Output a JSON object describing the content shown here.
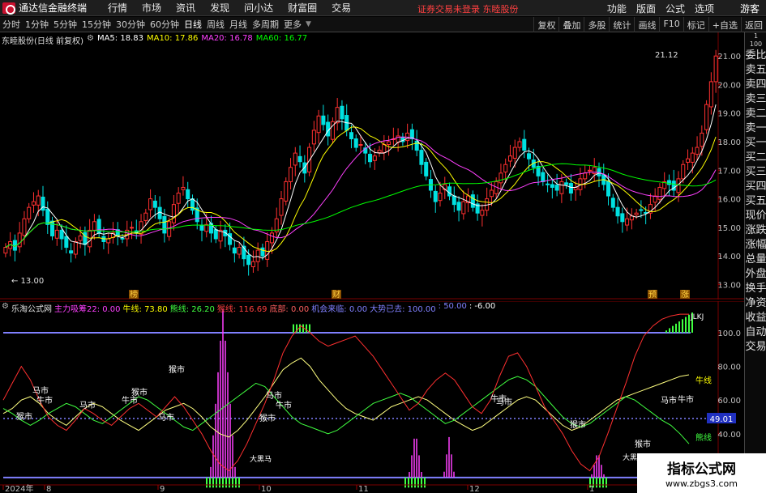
{
  "titlebar": {
    "app_title": "通达信金融终端",
    "menu": [
      "行情",
      "市场",
      "资讯",
      "发现",
      "问小达",
      "财富圈",
      "交易"
    ],
    "notice": "证券交易未登录  东睦股份",
    "right_menu": [
      "功能",
      "版面",
      "公式",
      "选项"
    ],
    "guest": "游客"
  },
  "toolbar": {
    "periods": [
      "分时",
      "1分钟",
      "5分钟",
      "15分钟",
      "30分钟",
      "60分钟",
      "日线",
      "周线",
      "月线",
      "多周期",
      "更多"
    ],
    "active_period": "日线",
    "tools": [
      "复权",
      "叠加",
      "多股",
      "统计",
      "画线",
      "F10",
      "标记",
      "+自选",
      "返回"
    ]
  },
  "main_chart": {
    "stock_label": "东睦股份(日线 前复权)",
    "ma": [
      {
        "label": "MA5: 18.83",
        "color": "#ffffff"
      },
      {
        "label": "MA10: 17.86",
        "color": "#ffff00"
      },
      {
        "label": "MA20: 16.78",
        "color": "#ff40ff"
      },
      {
        "label": "MA60: 16.77",
        "color": "#00ff00"
      }
    ],
    "high_label": "21.12",
    "low_label": "13.00",
    "event_markers": [
      {
        "text": "榜",
        "x": 165
      },
      {
        "text": "财",
        "x": 415
      },
      {
        "text": "预",
        "x": 805
      },
      {
        "text": "涨",
        "x": 845
      }
    ]
  },
  "chart_data": [
    {
      "type": "candlestick",
      "ylim": [
        12.7,
        21.6
      ],
      "yticks": [
        "21.00",
        "20.00",
        "19.00",
        "18.00",
        "17.00",
        "16.00",
        "15.00",
        "14.00",
        "13.00"
      ],
      "ytick_values": [
        21,
        20,
        19,
        18,
        17,
        16,
        15,
        14,
        13
      ],
      "close": [
        14.3,
        14.5,
        14.2,
        14.8,
        15.3,
        15.7,
        15.9,
        16.1,
        15.6,
        15.1,
        14.7,
        14.9,
        14.6,
        14.3,
        14.1,
        14.5,
        14.7,
        14.4,
        14.9,
        15.2,
        14.8,
        14.5,
        14.6,
        14.8,
        14.7,
        14.6,
        14.9,
        15.0,
        14.8,
        15.2,
        15.5,
        16.0,
        15.7,
        15.3,
        14.8,
        15.2,
        15.8,
        16.2,
        16.4,
        16.0,
        15.6,
        15.2,
        14.9,
        15.1,
        14.8,
        14.6,
        14.9,
        14.7,
        14.4,
        14.1,
        14.3,
        13.9,
        13.7,
        13.8,
        14.2,
        14.0,
        14.5,
        14.8,
        15.3,
        16.0,
        16.6,
        17.1,
        17.6,
        17.3,
        16.9,
        17.8,
        18.4,
        18.9,
        18.6,
        18.2,
        18.7,
        19.2,
        18.8,
        18.4,
        18.1,
        17.8,
        17.9,
        17.6,
        17.3,
        17.5,
        17.7,
        17.9,
        18.0,
        18.1,
        18.2,
        18.0,
        18.3,
        18.1,
        17.7,
        17.2,
        16.8,
        16.3,
        15.9,
        16.2,
        16.5,
        16.1,
        15.8,
        15.6,
        15.9,
        16.1,
        15.7,
        15.5,
        15.6,
        16.0,
        16.3,
        16.6,
        16.9,
        17.2,
        17.5,
        17.8,
        18.0,
        17.7,
        17.4,
        17.1,
        16.8,
        16.6,
        16.5,
        16.4,
        16.3,
        16.6,
        16.5,
        16.2,
        16.4,
        16.7,
        16.9,
        17.0,
        17.1,
        16.8,
        16.5,
        16.1,
        15.7,
        15.4,
        15.2,
        15.3,
        15.4,
        15.5,
        15.6,
        15.5,
        15.8,
        16.1,
        16.4,
        16.6,
        16.5,
        16.3,
        16.7,
        17.2,
        17.4,
        17.6,
        17.8,
        18.3,
        19.3,
        20.1,
        21.0
      ],
      "series": [
        {
          "name": "MA5",
          "color": "#ffffff"
        },
        {
          "name": "MA10",
          "color": "#ffff00"
        },
        {
          "name": "MA20",
          "color": "#ff40ff"
        },
        {
          "name": "MA60",
          "color": "#00ff00"
        }
      ]
    },
    {
      "type": "line",
      "ylim": [
        12,
        112
      ],
      "yticks": [
        "100.0",
        "80.00",
        "60.00",
        "40.00",
        "20.00"
      ],
      "ytick_values": [
        100,
        80,
        60,
        40,
        20
      ],
      "series": [
        {
          "name": "牛线",
          "color": "#ffff80",
          "values": [
            52,
            55,
            60,
            62,
            58,
            52,
            48,
            45,
            50,
            55,
            58,
            56,
            52,
            48,
            45,
            42,
            46,
            50,
            54,
            56,
            58,
            55,
            50,
            44,
            40,
            38,
            42,
            48,
            55,
            62,
            70,
            78,
            82,
            85,
            80,
            72,
            66,
            60,
            55,
            52,
            50,
            48,
            52,
            56,
            58,
            60,
            62,
            60,
            56,
            52,
            48,
            45,
            42,
            44,
            48,
            52,
            56,
            60,
            62,
            60,
            55,
            50,
            45,
            42,
            44,
            48,
            52,
            56,
            60,
            62,
            64,
            66,
            68,
            70,
            72,
            74,
            75
          ]
        },
        {
          "name": "熊线",
          "color": "#40ff40",
          "values": [
            55,
            52,
            48,
            45,
            48,
            52,
            55,
            58,
            56,
            52,
            48,
            46,
            50,
            54,
            58,
            62,
            60,
            56,
            52,
            48,
            44,
            42,
            46,
            50,
            54,
            58,
            62,
            66,
            70,
            68,
            62,
            56,
            50,
            46,
            44,
            42,
            40,
            42,
            46,
            50,
            54,
            58,
            60,
            62,
            64,
            62,
            58,
            54,
            50,
            46,
            48,
            52,
            56,
            60,
            64,
            68,
            72,
            74,
            72,
            68,
            62,
            56,
            50,
            46,
            44,
            46,
            50,
            54,
            58,
            62,
            60,
            56,
            52,
            48,
            45,
            40,
            34
          ]
        },
        {
          "name": "猴线",
          "color": "#ff3030",
          "values": [
            60,
            70,
            80,
            72,
            60,
            50,
            45,
            42,
            48,
            55,
            52,
            48,
            45,
            50,
            55,
            58,
            54,
            50,
            56,
            62,
            56,
            48,
            40,
            30,
            22,
            18,
            24,
            34,
            46,
            58,
            72,
            88,
            98,
            104,
            100,
            95,
            92,
            94,
            96,
            98,
            92,
            86,
            78,
            70,
            62,
            54,
            58,
            66,
            72,
            76,
            72,
            64,
            56,
            52,
            60,
            74,
            86,
            88,
            80,
            68,
            56,
            48,
            40,
            30,
            22,
            18,
            26,
            40,
            55,
            70,
            86,
            98,
            104,
            108,
            110,
            112,
            114
          ]
        }
      ],
      "threshold_lines": [
        100,
        14
      ],
      "dotted_line": 49.01
    }
  ],
  "sub_chart": {
    "formula_name": "乐淘公式网",
    "items": [
      {
        "text": "主力吸筹22: 0.00",
        "color": "#ff40ff"
      },
      {
        "text": "牛线: 73.80",
        "color": "#ffff00"
      },
      {
        "text": "熊线: 26.20",
        "color": "#40ff40"
      },
      {
        "text": "猴线: 116.69",
        "color": "#ff4040"
      },
      {
        "text": "底部: 0.00",
        "color": "#ff6060"
      },
      {
        "text": "机会来临: 0.00",
        "color": "#8080ff"
      },
      {
        "text": "大势已去: 100.00",
        "color": "#8080ff"
      },
      {
        "text": ": 50.00",
        "color": "#8080ff"
      },
      {
        "text": ": -6.00",
        "color": "#ffffff"
      }
    ],
    "current_value": "49.01",
    "right_labels": [
      "牛线",
      "熊线"
    ],
    "annotations": [
      {
        "text": "马市",
        "x": 40,
        "y": 114
      },
      {
        "text": "牛市",
        "x": 45,
        "y": 126
      },
      {
        "text": "猴市",
        "x": 20,
        "y": 146
      },
      {
        "text": "马市",
        "x": 98,
        "y": 132
      },
      {
        "text": "牛市",
        "x": 150,
        "y": 126
      },
      {
        "text": "猴市",
        "x": 162,
        "y": 116
      },
      {
        "text": "马市",
        "x": 195,
        "y": 147
      },
      {
        "text": "猴市",
        "x": 208,
        "y": 88
      },
      {
        "text": "马市",
        "x": 328,
        "y": 120
      },
      {
        "text": "牛市",
        "x": 340,
        "y": 132
      },
      {
        "text": "猴市",
        "x": 320,
        "y": 148
      },
      {
        "text": "牛市",
        "x": 605,
        "y": 124
      },
      {
        "text": "马市",
        "x": 612,
        "y": 128
      },
      {
        "text": "猴市",
        "x": 703,
        "y": 156
      },
      {
        "text": "牛市",
        "x": 836,
        "y": 125
      },
      {
        "text": "马市",
        "x": 815,
        "y": 126
      },
      {
        "text": "猴市",
        "x": 783,
        "y": 180
      },
      {
        "text": "大黑马",
        "x": 308,
        "y": 198
      },
      {
        "text": "大黑马",
        "x": 768,
        "y": 196
      },
      {
        "text": "JLKJ",
        "x": 852,
        "y": 22
      }
    ],
    "x_labels": [
      {
        "text": "2024年",
        "x": 4
      },
      {
        "text": "8",
        "x": 55
      },
      {
        "text": "9",
        "x": 195
      },
      {
        "text": "10",
        "x": 320
      },
      {
        "text": "11",
        "x": 440
      },
      {
        "text": "12",
        "x": 577
      },
      {
        "text": "1",
        "x": 725
      }
    ]
  },
  "sidebar": {
    "items": [
      "委比",
      "卖五",
      "卖四",
      "卖三",
      "卖二",
      "卖一",
      "买一",
      "买二",
      "买三",
      "买四",
      "买五",
      "现价",
      "涨跌",
      "涨幅",
      "总量",
      "外盘",
      "换手",
      "净资",
      "收益",
      "自动",
      "交易"
    ],
    "small_top": [
      "1",
      "100"
    ]
  },
  "watermark": {
    "title": "指标公式网",
    "url": "www.zbgs3.com"
  }
}
